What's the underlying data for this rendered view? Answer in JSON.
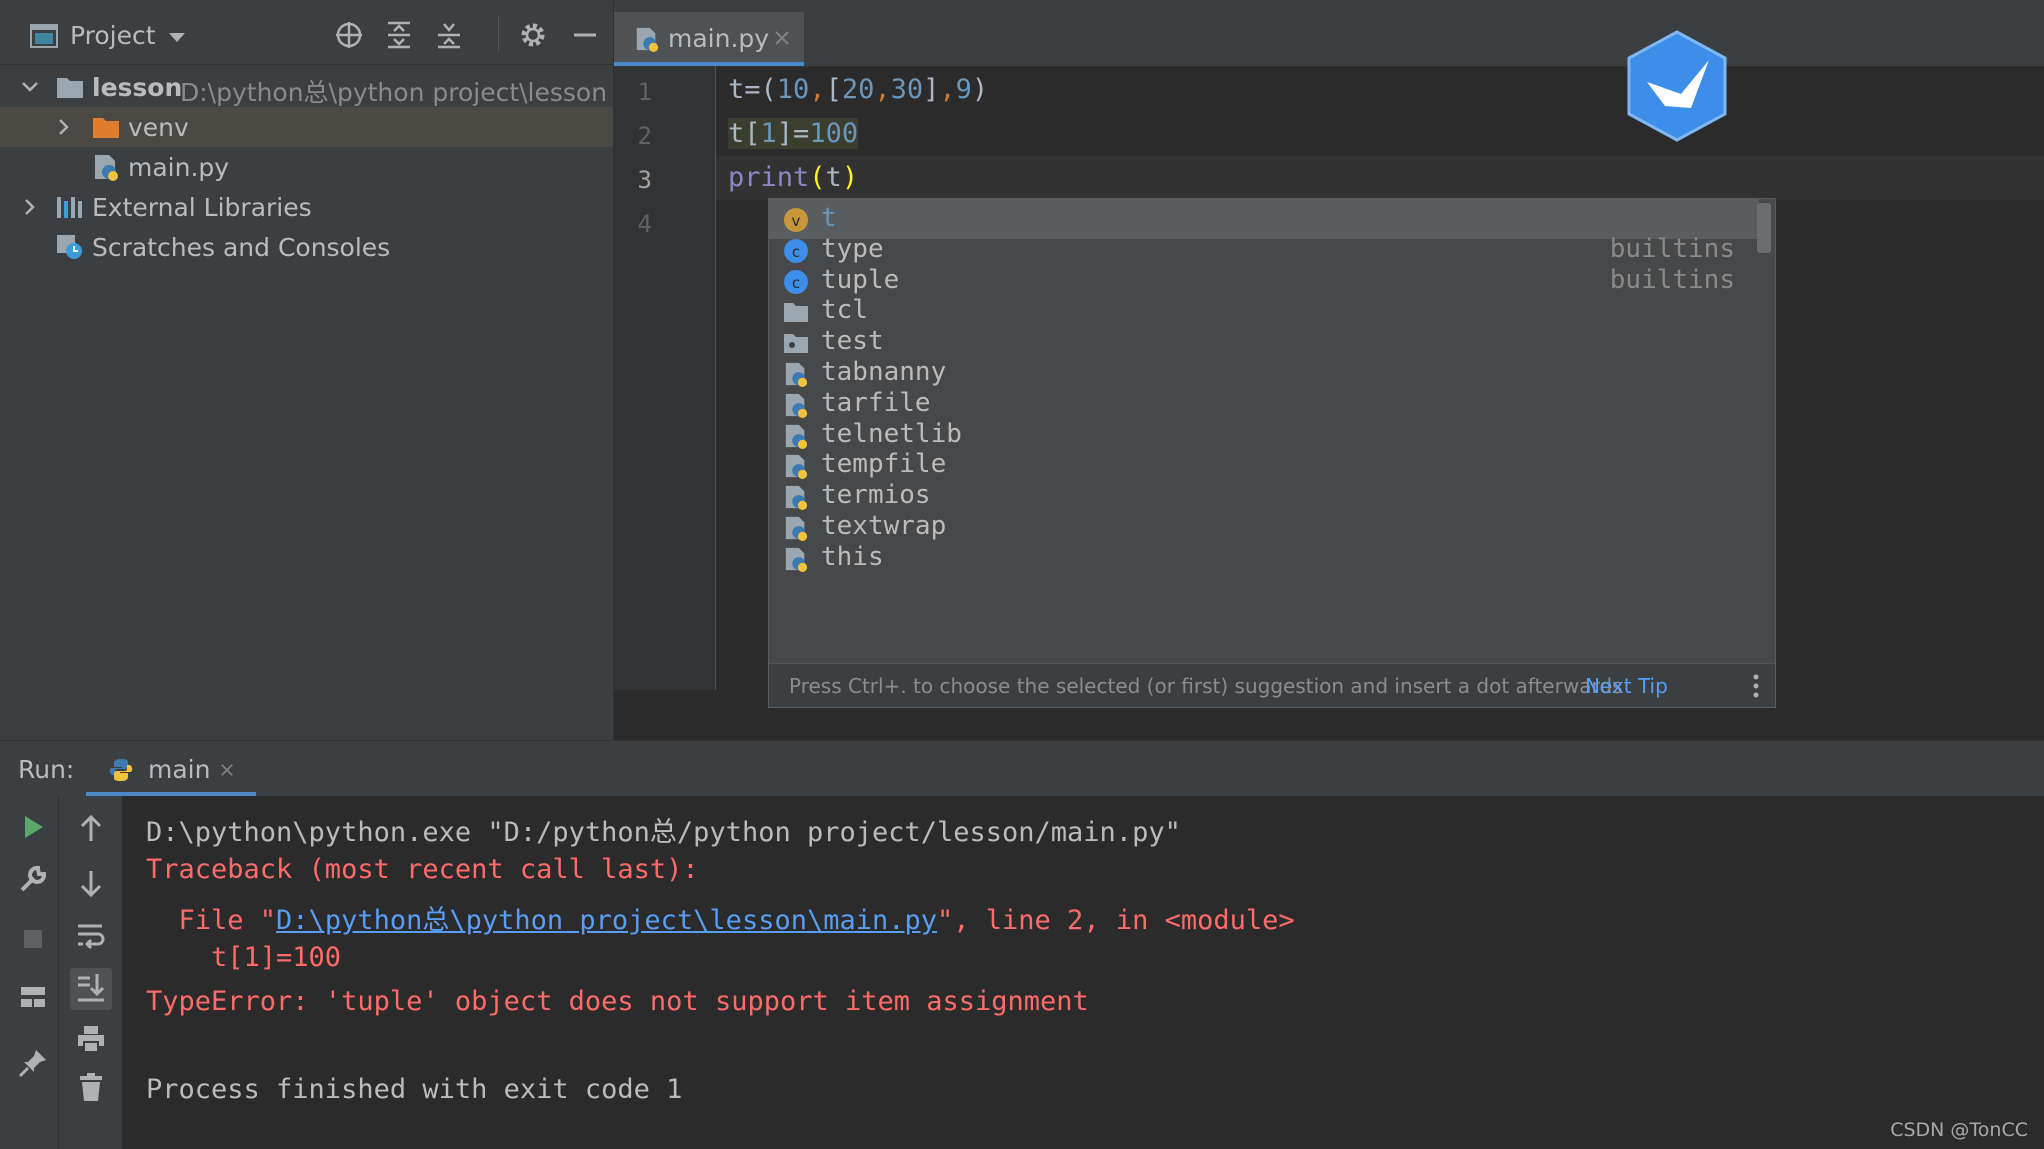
{
  "project": {
    "title": "Project",
    "tree": [
      {
        "label": "lesson",
        "path": "D:\\python总\\python project\\lesson"
      },
      {
        "label": "venv"
      },
      {
        "label": "main.py"
      },
      {
        "label": "External Libraries"
      },
      {
        "label": "Scratches and Consoles"
      }
    ]
  },
  "editor": {
    "tab": {
      "label": "main.py"
    },
    "line_numbers": [
      "1",
      "2",
      "3",
      "4"
    ],
    "code": {
      "line1": [
        {
          "t": "t",
          "c": "#a9b7c6"
        },
        {
          "t": "=(",
          "c": "#a9b7c6"
        },
        {
          "t": "10",
          "c": "#6897bb"
        },
        {
          "t": ",",
          "c": "#cc7832"
        },
        {
          "t": "[",
          "c": "#a9b7c6"
        },
        {
          "t": "20",
          "c": "#6897bb"
        },
        {
          "t": ",",
          "c": "#cc7832"
        },
        {
          "t": "30",
          "c": "#6897bb"
        },
        {
          "t": "]",
          "c": "#a9b7c6"
        },
        {
          "t": ",",
          "c": "#cc7832"
        },
        {
          "t": "9",
          "c": "#6897bb"
        },
        {
          "t": ")",
          "c": "#a9b7c6"
        }
      ],
      "line2": [
        {
          "t": "t",
          "c": "#a9b7c6"
        },
        {
          "t": "[",
          "c": "#a9b7c6"
        },
        {
          "t": "1",
          "c": "#6897bb"
        },
        {
          "t": "]=",
          "c": "#a9b7c6"
        },
        {
          "t": "100",
          "c": "#6897bb"
        }
      ],
      "line3": [
        {
          "t": "print",
          "c": "#8888c6"
        },
        {
          "t": "(",
          "c": "#ffef28"
        },
        {
          "t": "t",
          "c": "#a9b7c6"
        },
        {
          "t": ")",
          "c": "#ffef28"
        }
      ]
    }
  },
  "completion": {
    "items": [
      {
        "icon": "variable-icon",
        "label": "t",
        "type": ""
      },
      {
        "icon": "class-icon",
        "label": "type",
        "type": "builtins"
      },
      {
        "icon": "class-icon",
        "label": "tuple",
        "type": "builtins"
      },
      {
        "icon": "folder-icon",
        "label": "tcl",
        "type": ""
      },
      {
        "icon": "package-icon",
        "label": "test",
        "type": ""
      },
      {
        "icon": "python-file-icon",
        "label": "tabnanny",
        "type": ""
      },
      {
        "icon": "python-file-icon",
        "label": "tarfile",
        "type": ""
      },
      {
        "icon": "python-file-icon",
        "label": "telnetlib",
        "type": ""
      },
      {
        "icon": "python-file-icon",
        "label": "tempfile",
        "type": ""
      },
      {
        "icon": "python-file-icon",
        "label": "termios",
        "type": ""
      },
      {
        "icon": "python-file-icon",
        "label": "textwrap",
        "type": ""
      },
      {
        "icon": "python-file-icon",
        "label": "this",
        "type": ""
      }
    ],
    "hint": "Press Ctrl+. to choose the selected (or first) suggestion and insert a dot afterwards",
    "next_tip": "Next Tip"
  },
  "run": {
    "label": "Run:",
    "tab": "main",
    "console": {
      "cmd": "D:\\python\\python.exe \"D:/python总/python project/lesson/main.py\"",
      "traceback": "Traceback (most recent call last):",
      "file_prefix": "  File \"",
      "file_link": "D:\\python总\\python project\\lesson\\main.py",
      "file_suffix": "\", line 2, in <module>",
      "code_line": "    t[1]=100",
      "error": "TypeError: 'tuple' object does not support item assignment",
      "exit": "Process finished with exit code 1"
    }
  },
  "watermark": "CSDN @TonCC",
  "colors": {
    "accent": "#4a88c7",
    "error": "#ff6b68",
    "link": "#589df6",
    "number": "#6897bb",
    "keyword": "#cc7832"
  }
}
